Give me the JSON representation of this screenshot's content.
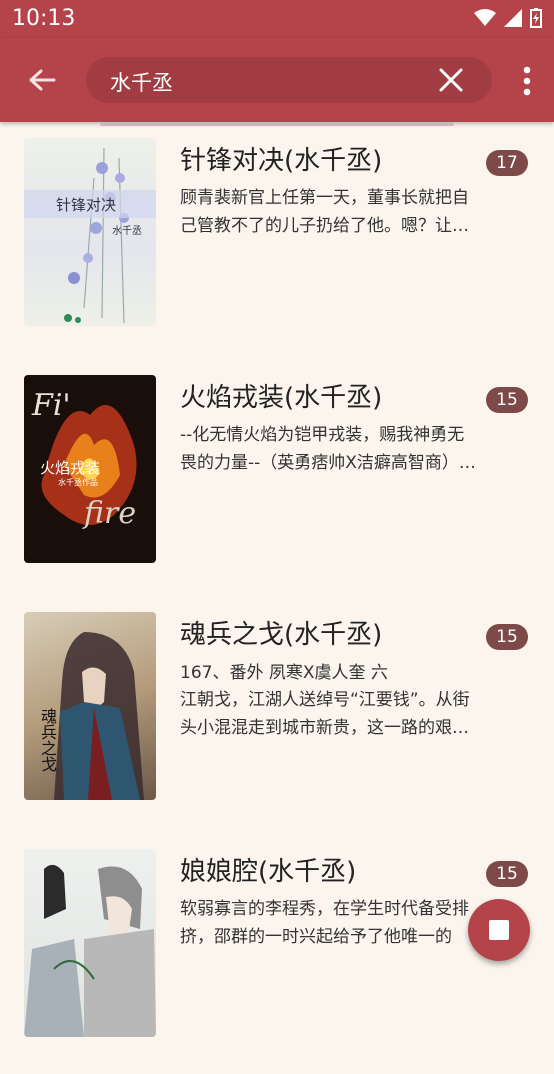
{
  "status": {
    "time": "10:13"
  },
  "search": {
    "query": "水千丞"
  },
  "books": [
    {
      "title": "针锋对决(水千丞)",
      "count": "17",
      "desc_line1": "顾青裴新官上任第一天，董事长就把自",
      "desc_line2": "己管教不了的儿子扔给了他。嗯？让…",
      "cover_text": "针锋对决",
      "cover_author": "水千丞"
    },
    {
      "title": "火焰戎装(水千丞)",
      "count": "15",
      "desc_line1": "--化无情火焰为铠甲戎装，赐我神勇无",
      "desc_line2": "畏的力量--（英勇痞帅X洁癖高智商）…",
      "cover_text": "火焰戎装",
      "cover_author": "水千丞作品"
    },
    {
      "title": "魂兵之戈(水千丞)",
      "count": "15",
      "latest": "167、番外 夙寒X虞人奎 六",
      "desc_line1": "江朝戈，江湖人送绰号“江要钱”。从街",
      "desc_line2": "头小混混走到城市新贵，这一路的艰…",
      "cover_text": "魂兵之戈"
    },
    {
      "title": "娘娘腔(水千丞)",
      "count": "15",
      "desc_line1": "软弱寡言的李程秀，在学生时代备受排",
      "desc_line2": "挤，邵群的一时兴起给予了他唯一的"
    }
  ],
  "colors": {
    "primary": "#b4434a",
    "badge": "#7e4a49",
    "background": "#fbf5ee"
  }
}
